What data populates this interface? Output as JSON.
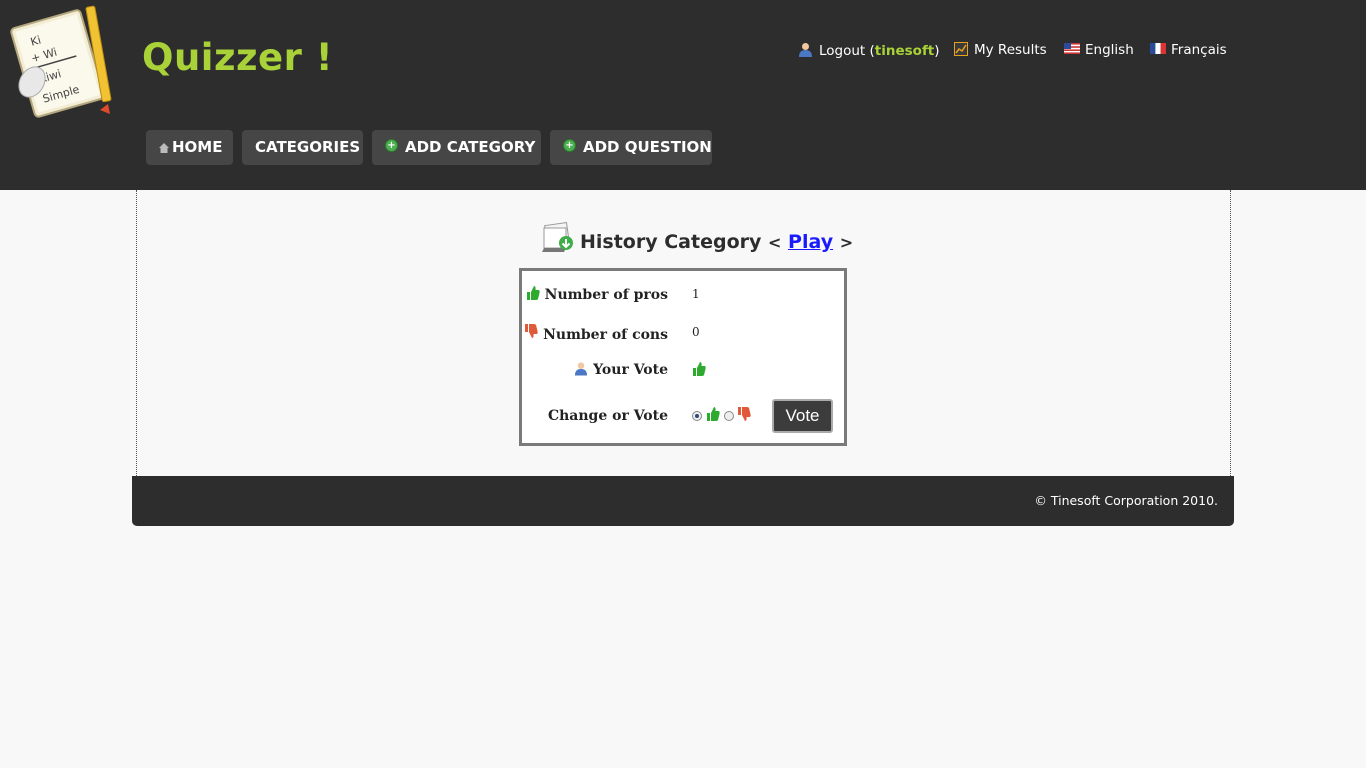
{
  "header": {
    "site_title": "Quizzer !",
    "logo_text": [
      "Ki",
      "+ Wi",
      "Kiwi",
      "Simple"
    ],
    "links": {
      "logout_prefix": "Logout (",
      "username": "tinesoft",
      "logout_suffix": ")",
      "my_results": "My Results",
      "english": "English",
      "francais": "Français"
    }
  },
  "nav": {
    "home": "HOME",
    "categories": "CATEGORIES",
    "add_category": "ADD CATEGORY",
    "add_question": "ADD QUESTION"
  },
  "category": {
    "title": "History Category",
    "open_bracket": "<",
    "play_link": "Play",
    "close_bracket": ">"
  },
  "vote_table": {
    "pros_label": "Number of pros",
    "pros_value": "1",
    "cons_label": "Number of cons",
    "cons_value": "0",
    "your_vote_label": "Your Vote",
    "your_vote": "pro",
    "change_label": "Change or Vote",
    "selected_option": "pro",
    "vote_button": "Vote"
  },
  "footer": {
    "copyright": "© Tinesoft Corporation 2010."
  },
  "colors": {
    "header_bg": "#2d2d2d",
    "accent_green": "#a9d138",
    "link_blue": "#1a1aff",
    "thumb_up": "#2eaa2e",
    "thumb_down": "#e05a3a"
  }
}
